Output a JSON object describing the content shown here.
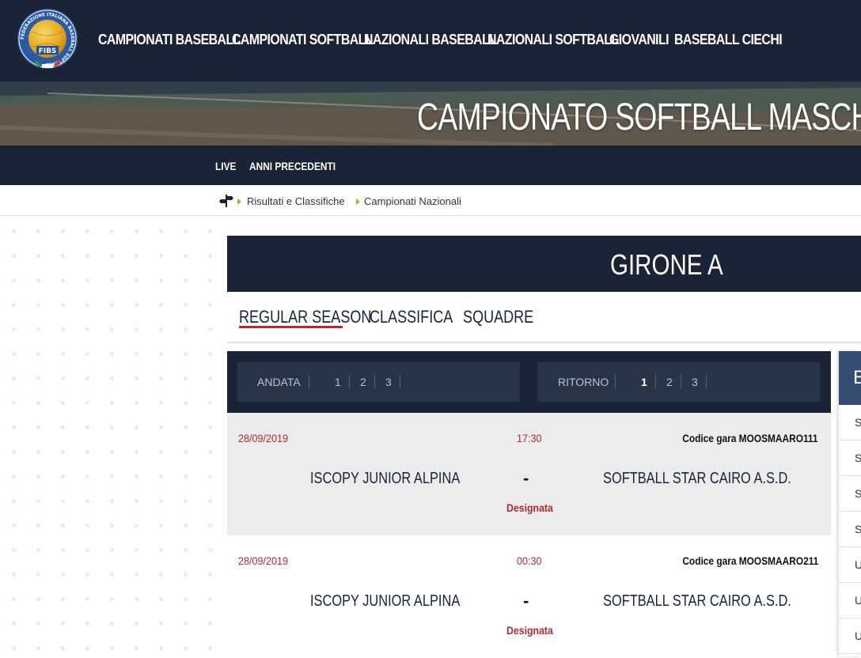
{
  "topnav": {
    "logo_text": "FIBS",
    "logo_ring_text": "FEDERAZIONE ITALIANA BASEBALL SOFTBALL",
    "items": [
      {
        "label": "CAMPIONATI BASEBALL"
      },
      {
        "label": "CAMPIONATI SOFTBALL"
      },
      {
        "label": "NAZIONALI BASEBALL"
      },
      {
        "label": "NAZIONALI SOFTBALL"
      },
      {
        "label": "GIOVANILI"
      },
      {
        "label": "BASEBALL CIECHI"
      }
    ]
  },
  "hero": {
    "title": "CAMPIONATO SOFTBALL MASCH"
  },
  "subnav": {
    "live": "LIVE",
    "past_years": "ANNI PRECEDENTI"
  },
  "breadcrumb": {
    "home_icon": "signpost-icon",
    "items": [
      "Risultati e Classifiche",
      "Campionati Nazionali"
    ]
  },
  "group": {
    "title": "GIRONE A"
  },
  "tabs": [
    {
      "label": "REGULAR SEASON",
      "active": true
    },
    {
      "label": "CLASSIFICA",
      "active": false
    },
    {
      "label": "SQUADRE",
      "active": false
    }
  ],
  "rounds": {
    "andata": {
      "label": "ANDATA",
      "numbers": [
        "1",
        "2",
        "3"
      ]
    },
    "ritorno": {
      "label": "RITORNO",
      "numbers": [
        "1",
        "2",
        "3"
      ],
      "active": "1"
    }
  },
  "games": [
    {
      "date": "28/09/2019",
      "time": "17:30",
      "code": "Codice gara MOOSMAARO111",
      "home": "ISCOPY JUNIOR ALPINA",
      "score": "-",
      "away": "SOFTBALL STAR CAIRO A.S.D.",
      "status": "Designata"
    },
    {
      "date": "28/09/2019",
      "time": "00:30",
      "code": "Codice gara MOOSMAARO211",
      "home": "ISCOPY JUNIOR ALPINA",
      "score": "-",
      "away": "SOFTBALL STAR CAIRO A.S.D.",
      "status": "Designata"
    }
  ],
  "side_panel": {
    "header_letter": "B",
    "rows": [
      "S",
      "S",
      "S",
      "S",
      "U",
      "U",
      "U"
    ]
  },
  "colors": {
    "navy": "#1a2436",
    "accent_red": "#c0262d",
    "date_red": "#b02a2f",
    "breadcrumb_arrow": "#e0952b",
    "side_header": "#344b72"
  }
}
